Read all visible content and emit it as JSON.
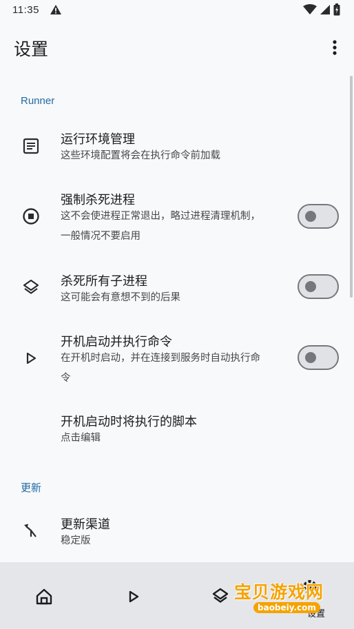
{
  "status": {
    "time": "11:35"
  },
  "appbar": {
    "title": "设置",
    "menu_icon": "more-vert-icon"
  },
  "sections": {
    "runner": {
      "header": "Runner"
    },
    "update": {
      "header": "更新"
    }
  },
  "items": {
    "env": {
      "title": "运行环境管理",
      "subtitle": "这些环境配置将会在执行命令前加载",
      "icon": "article-icon"
    },
    "force_kill": {
      "title": "强制杀死进程",
      "subtitle_line1": "这不会使进程正常退出，略过进程清理机制，",
      "subtitle_line2": "一般情况不要启用",
      "icon": "stop-circle-icon",
      "enabled": false
    },
    "kill_children": {
      "title": "杀死所有子进程",
      "subtitle": "这可能会有意想不到的后果",
      "icon": "layers-icon",
      "enabled": false
    },
    "boot_run": {
      "title": "开机启动并执行命令",
      "subtitle_line1": "在开机时启动，并在连接到服务时自动执行命",
      "subtitle_line2": "令",
      "icon": "play-arrow-icon",
      "enabled": false
    },
    "boot_script": {
      "title": "开机启动时将执行的脚本",
      "subtitle": "点击编辑"
    },
    "channel": {
      "title": "更新渠道",
      "subtitle": "稳定版",
      "icon": "merge-icon"
    }
  },
  "bottom_nav": {
    "items": [
      "home-icon",
      "play-arrow-icon",
      "layers-icon",
      "settings-icon"
    ],
    "settings_label": "设置"
  },
  "watermark": {
    "text": "宝贝游戏网",
    "url": "baobeiy.com"
  }
}
